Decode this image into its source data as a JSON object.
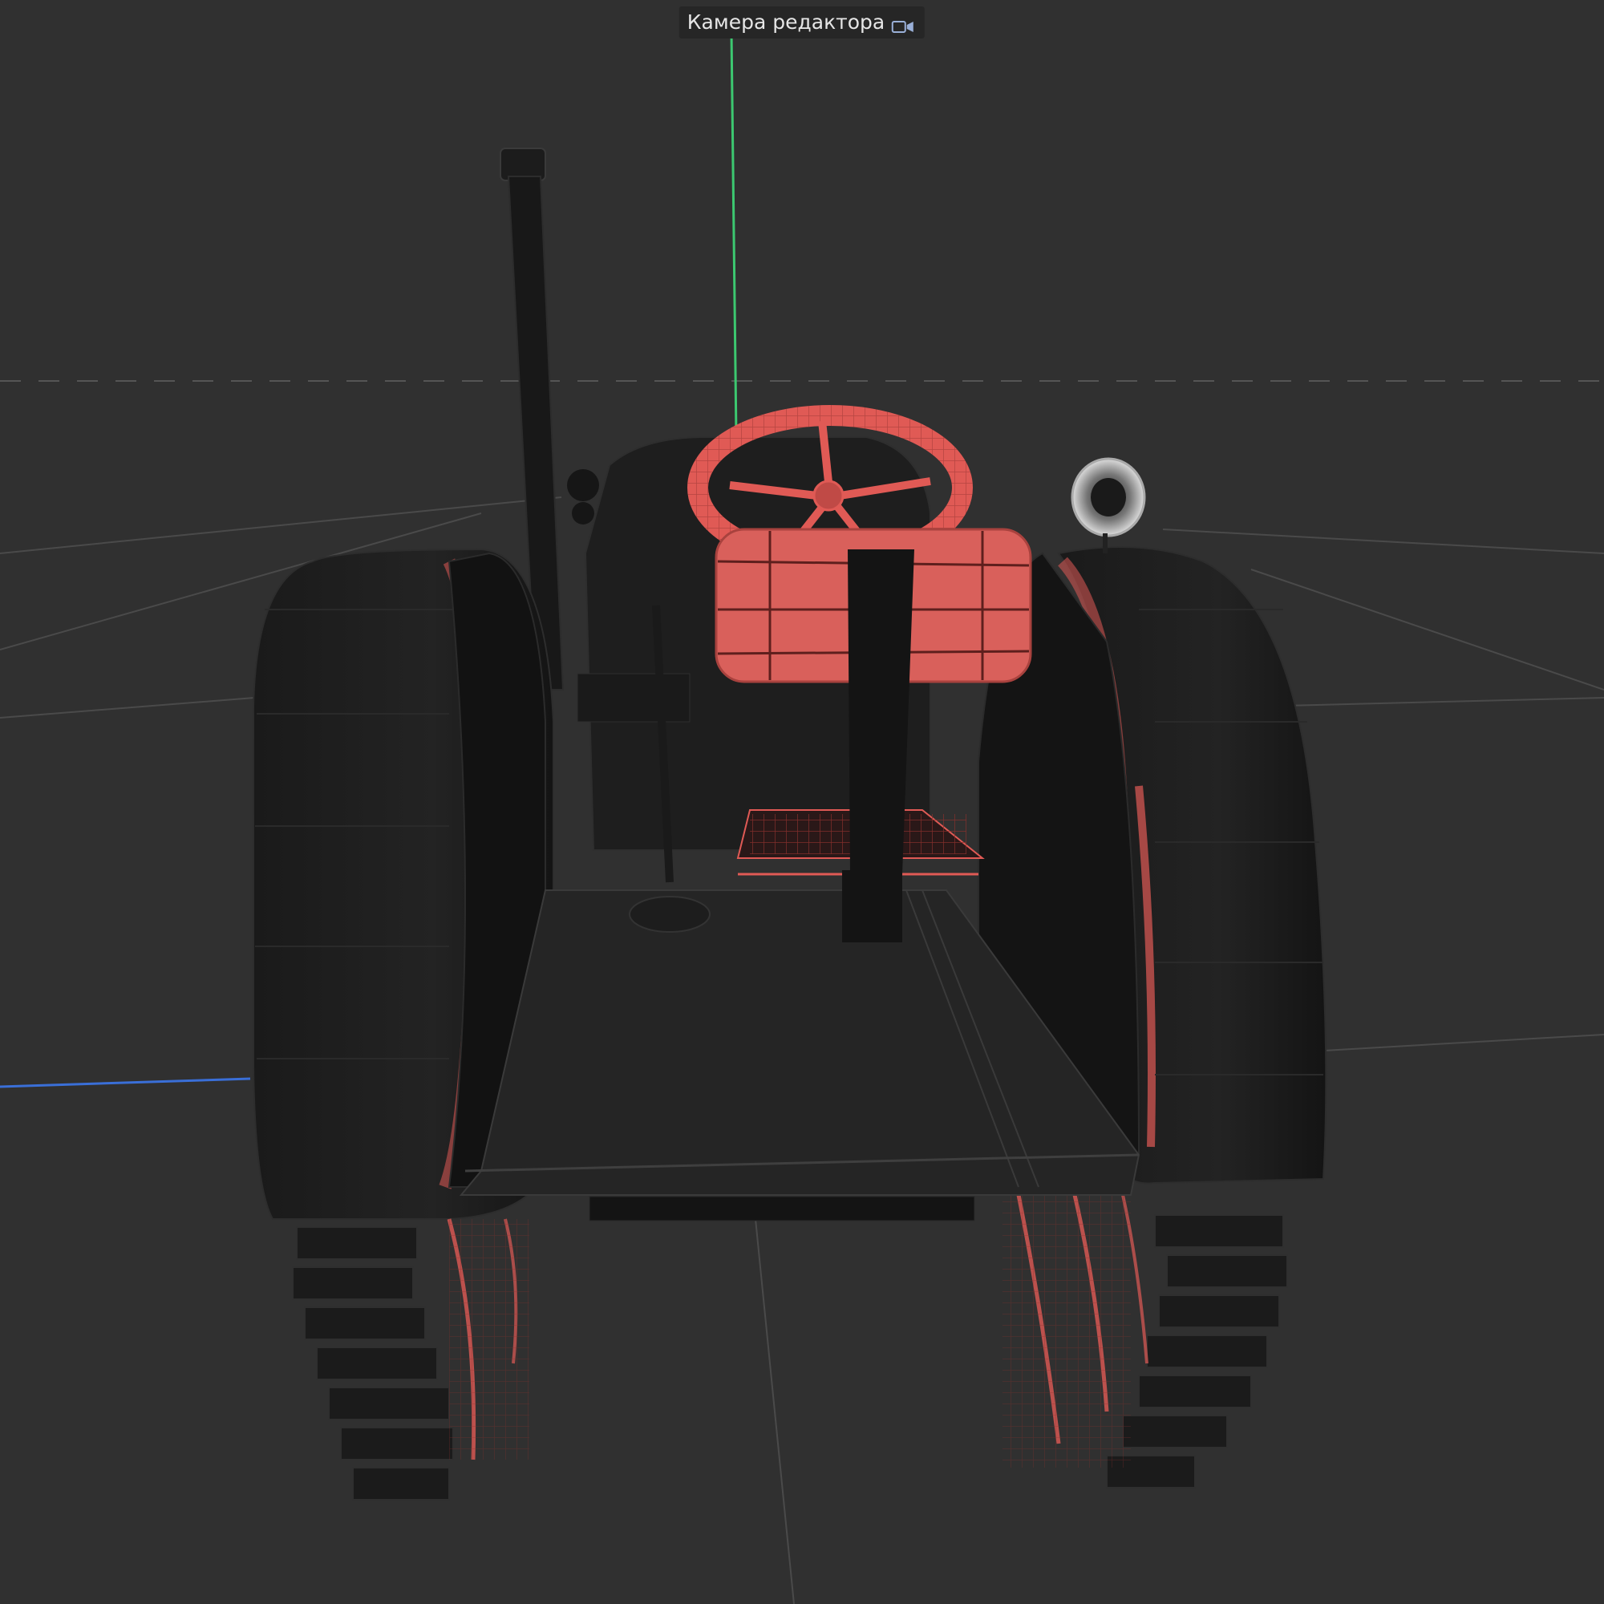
{
  "viewport": {
    "camera_label": "Камера редактора",
    "camera_icon": "camera-icon",
    "axis_colors": {
      "y_axis": "#3cc870",
      "x_axis": "#3a6fd8"
    },
    "selection_color": "#e05a55",
    "grid_color": "#4a4a4a",
    "background": "#303030"
  }
}
